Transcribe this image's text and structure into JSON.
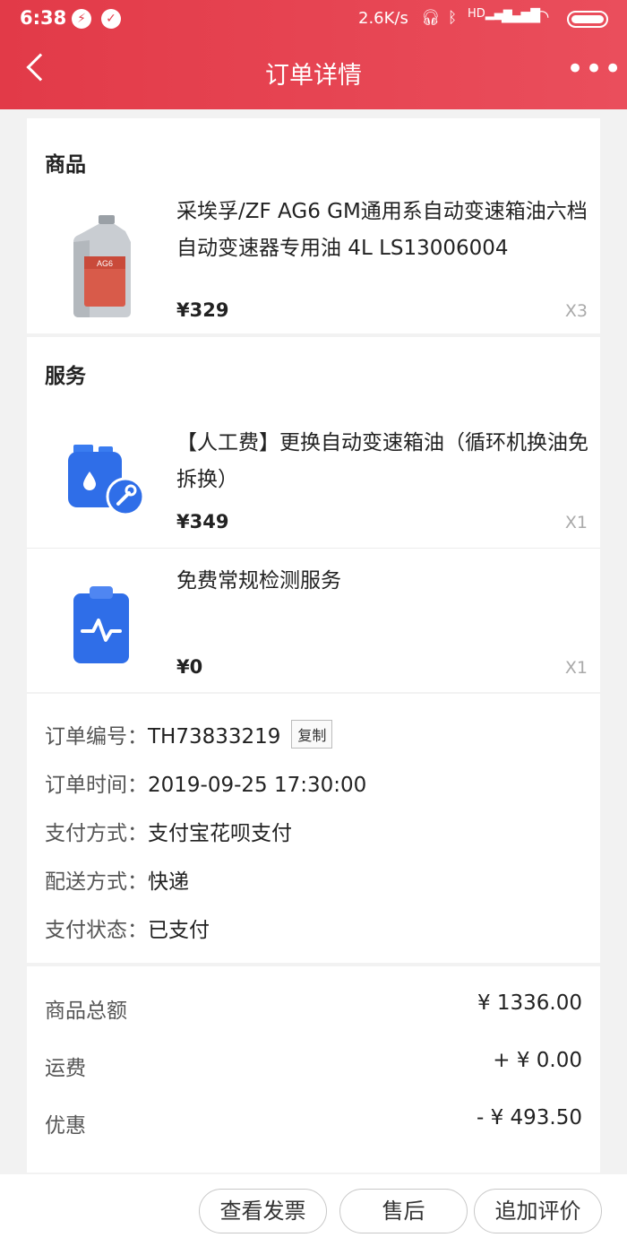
{
  "status_bar": {
    "time": "6:38",
    "network_speed": "2.6K/s",
    "icons": [
      "shield-icon",
      "check-icon",
      "headphone-icon",
      "bluetooth-icon",
      "hd-signal-icon",
      "signal-icon",
      "wifi-icon",
      "battery-icon"
    ]
  },
  "nav": {
    "title": "订单详情",
    "back_icon": "back-arrow-icon",
    "more_icon": "more-icon"
  },
  "products": {
    "section_title": "商品",
    "items": [
      {
        "name": "采埃孚/ZF AG6 GM通用系自动变速箱油六档自动变速器专用油 4L LS13006004",
        "price": "¥329",
        "qty": "X3",
        "icon": "oil-bottle-image"
      }
    ]
  },
  "services": {
    "section_title": "服务",
    "items": [
      {
        "name": "【人工费】更换自动变速箱油（循环机换油免拆换）",
        "price": "¥349",
        "qty": "X1",
        "icon": "oil-change-wrench-icon"
      },
      {
        "name": "免费常规检测服务",
        "price": "¥0",
        "qty": "X1",
        "icon": "clipboard-check-icon"
      }
    ]
  },
  "order_info": {
    "number_label": "订单编号：",
    "number_value": "TH73833219",
    "copy_label": "复制",
    "time_label": "订单时间：",
    "time_value": "2019-09-25 17:30:00",
    "payment_label": "支付方式：",
    "payment_value": "支付宝花呗支付",
    "delivery_label": "配送方式：",
    "delivery_value": "快递",
    "status_label": "支付状态：",
    "status_value": "已支付"
  },
  "summary": {
    "subtotal_label": "商品总额",
    "subtotal_value": "¥ 1336.00",
    "shipping_label": "运费",
    "shipping_value": "+ ¥ 0.00",
    "discount_label": "优惠",
    "discount_value": "- ¥ 493.50"
  },
  "actions": {
    "invoice": "查看发票",
    "after_sales": "售后",
    "add_review": "追加评价"
  },
  "colors": {
    "header_red": "#e23a48",
    "icon_blue": "#2f6ee8"
  }
}
